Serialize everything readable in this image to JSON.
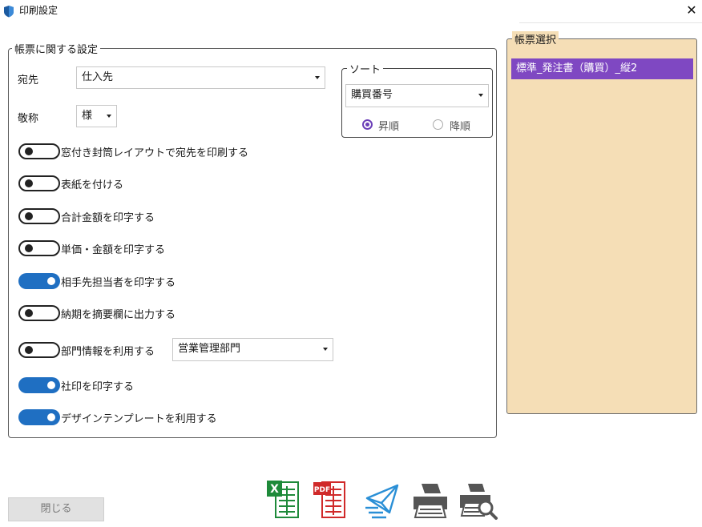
{
  "window": {
    "title": "印刷設定",
    "close_glyph": "✕",
    "icon": "app-shield-icon"
  },
  "report_settings": {
    "legend": "帳票に関する設定",
    "recipient_label": "宛先",
    "recipient_value": "仕入先",
    "honorific_label": "敬称",
    "honorific_value": "様",
    "options": [
      {
        "label": "窓付き封筒レイアウトで宛先を印刷する",
        "on": false
      },
      {
        "label": "表紙を付ける",
        "on": false
      },
      {
        "label": "合計金額を印字する",
        "on": false
      },
      {
        "label": "単価・金額を印字する",
        "on": false
      },
      {
        "label": "相手先担当者を印字する",
        "on": true
      },
      {
        "label": "納期を摘要欄に出力する",
        "on": false
      },
      {
        "label": "部門情報を利用する",
        "on": false
      },
      {
        "label": "社印を印字する",
        "on": true
      },
      {
        "label": "デザインテンプレートを利用する",
        "on": true
      }
    ],
    "department_value": "営業管理部門"
  },
  "sort": {
    "legend": "ソート",
    "field_value": "購買番号",
    "ascending_label": "昇順",
    "descending_label": "降順",
    "selected": "ascending"
  },
  "report_selection": {
    "legend": "帳票選択",
    "items": [
      "標準_発注書（購買）_縦2"
    ]
  },
  "footer": {
    "close_label": "閉じる",
    "excel_icon_text": "X",
    "pdf_icon_text": "PDF"
  },
  "colors": {
    "accent_purple": "#7f48c2",
    "toggle_on_blue": "#1f6fc2",
    "panel_bg": "#f5deb6",
    "excel_green": "#1e8a3a",
    "pdf_red": "#d02a2a",
    "mail_blue": "#2a8fd6",
    "printer_gray": "#555555"
  }
}
